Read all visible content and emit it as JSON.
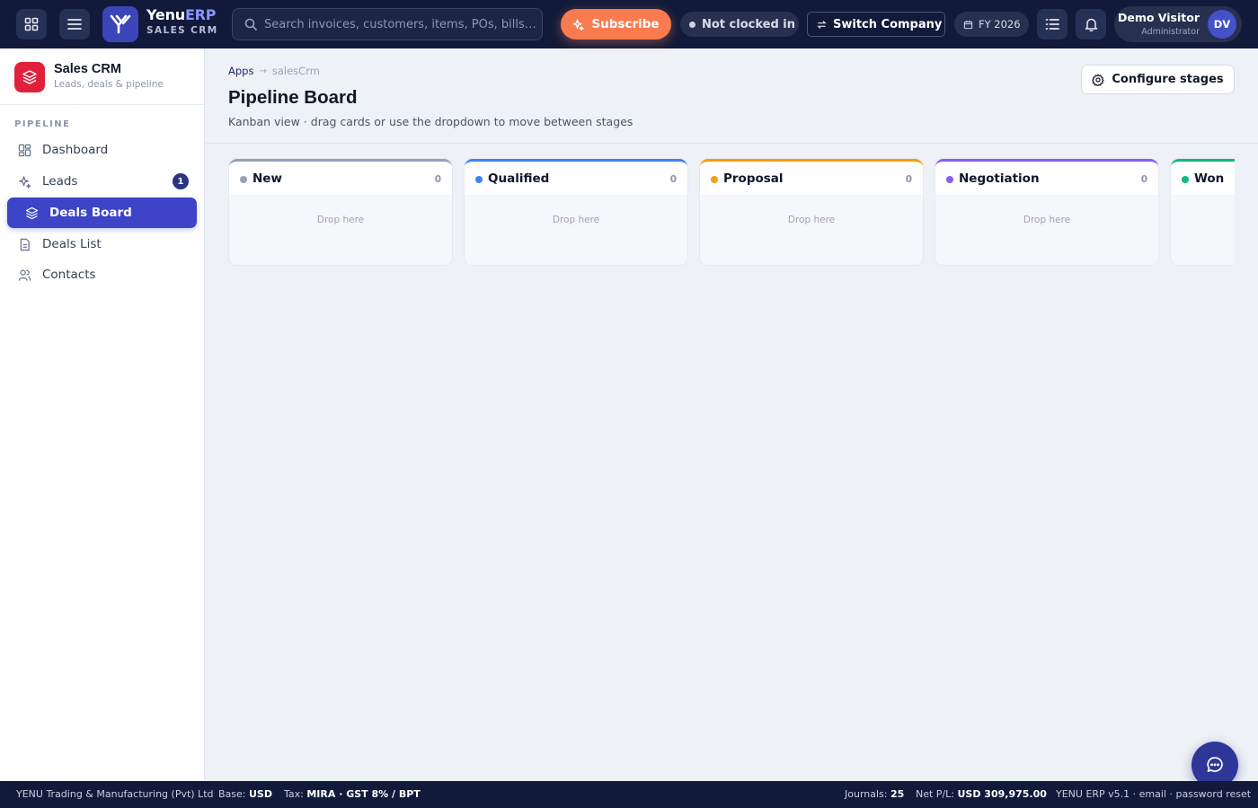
{
  "topbar": {
    "brand_prefix": "Yenu",
    "brand_suffix": "ERP",
    "brand_sub": "SALES CRM",
    "search_placeholder": "Search invoices, customers, items, POs, bills…",
    "subscribe_label": "Subscribe",
    "clock_status": "Not clocked in",
    "switch_company_label": "Switch Company",
    "fiscal_year": "FY 2026",
    "user_name": "Demo Visitor",
    "user_role": "Administrator",
    "user_initials": "DV"
  },
  "sidebar": {
    "app_name": "Sales CRM",
    "app_subtitle": "Leads, deals & pipeline",
    "section_label": "PIPELINE",
    "items": [
      {
        "label": "Dashboard",
        "icon": "dashboard-icon"
      },
      {
        "label": "Leads",
        "icon": "sparkle-icon",
        "badge": "1"
      },
      {
        "label": "Deals Board",
        "icon": "layers-icon",
        "active": true
      },
      {
        "label": "Deals List",
        "icon": "document-icon"
      },
      {
        "label": "Contacts",
        "icon": "users-icon"
      }
    ]
  },
  "main": {
    "breadcrumb": [
      "Apps",
      "salesCrm"
    ],
    "title": "Pipeline Board",
    "subtitle": "Kanban view · drag cards or use the dropdown to move between stages",
    "configure_label": "Configure stages",
    "stages": [
      {
        "name": "New",
        "count": "0",
        "color": "#94a3b8",
        "drop_text": "Drop here"
      },
      {
        "name": "Qualified",
        "count": "0",
        "color": "#3b82f6",
        "drop_text": "Drop here"
      },
      {
        "name": "Proposal",
        "count": "0",
        "color": "#f59e0b",
        "drop_text": "Drop here"
      },
      {
        "name": "Negotiation",
        "count": "0",
        "color": "#8b5cf6",
        "drop_text": "Drop here"
      },
      {
        "name": "Won",
        "count": "",
        "color": "#10b981",
        "drop_text": ""
      }
    ]
  },
  "footer": {
    "company": "YENU Trading & Manufacturing (Pvt) Ltd",
    "base_label": "Base:",
    "base_value": "USD",
    "tax_label": "Tax:",
    "tax_value": "MIRA · GST 8% / BPT",
    "journals_label": "Journals:",
    "journals_value": "25",
    "netpl_label": "Net P/L:",
    "netpl_value": "USD 309,975.00",
    "version": "YENU ERP v5.1 · email · password reset"
  },
  "colors": {
    "topbar_bg": "#111a3a",
    "accent": "#3d44c7",
    "subscribe": "#fa7b4f",
    "app_icon": "#e1203b"
  }
}
